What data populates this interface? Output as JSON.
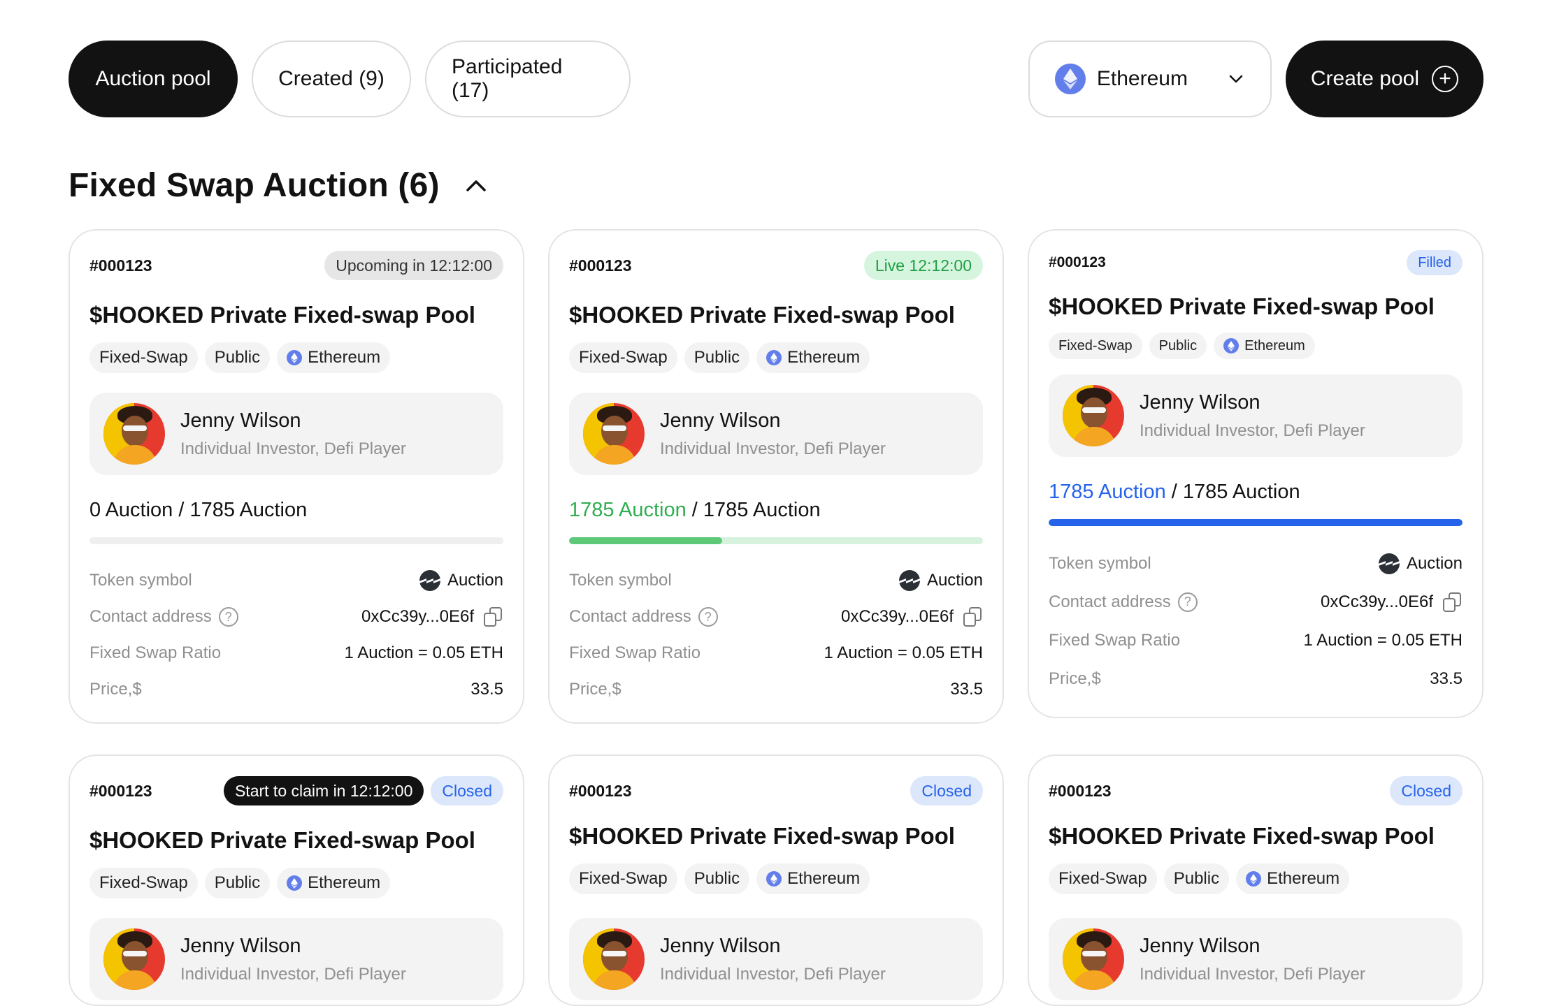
{
  "tabs": [
    {
      "label": "Auction pool",
      "active": true
    },
    {
      "label": "Created (9)",
      "active": false
    },
    {
      "label": "Participated (17)",
      "active": false
    }
  ],
  "chain_select": {
    "value": "Ethereum",
    "icon": "ethereum-icon"
  },
  "create_button": {
    "label": "Create pool",
    "icon": "plus-circle-icon"
  },
  "section": {
    "title": "Fixed Swap Auction (6)",
    "collapse_icon": "chevron-up-icon"
  },
  "common": {
    "title": "$HOOKED Private Fixed-swap Pool",
    "tags": [
      "Fixed-Swap",
      "Public",
      "Ethereum"
    ],
    "user_name": "Jenny Wilson",
    "user_role": "Individual Investor, Defi Player",
    "labels": {
      "token_symbol": "Token symbol",
      "contact_address": "Contact address",
      "ratio": "Fixed Swap Ratio",
      "price": "Price,$"
    },
    "values": {
      "token_symbol": "Auction",
      "contact_address": "0xCc39y...0E6f",
      "ratio": "1 Auction = 0.05 ETH",
      "price": "33.5"
    }
  },
  "cards": [
    {
      "id": "#000123",
      "status": "Upcoming in 12:12:00",
      "progress_sold": "0 Auction",
      "progress_total": " / 1785 Auction",
      "progress_fraction": 0.0
    },
    {
      "id": "#000123",
      "status": "Live 12:12:00",
      "progress_sold": "1785 Auction",
      "progress_total": " / 1785 Auction",
      "progress_fraction": 0.37
    },
    {
      "id": "#000123",
      "status": "Filled",
      "progress_sold": "1785 Auction",
      "progress_total": " / 1785 Auction",
      "progress_fraction": 1.0
    },
    {
      "id": "#000123",
      "claim": "Start to claim in  12:12:00",
      "status": "Closed"
    },
    {
      "id": "#000123",
      "status": "Closed"
    },
    {
      "id": "#000123",
      "status": "Closed"
    }
  ]
}
